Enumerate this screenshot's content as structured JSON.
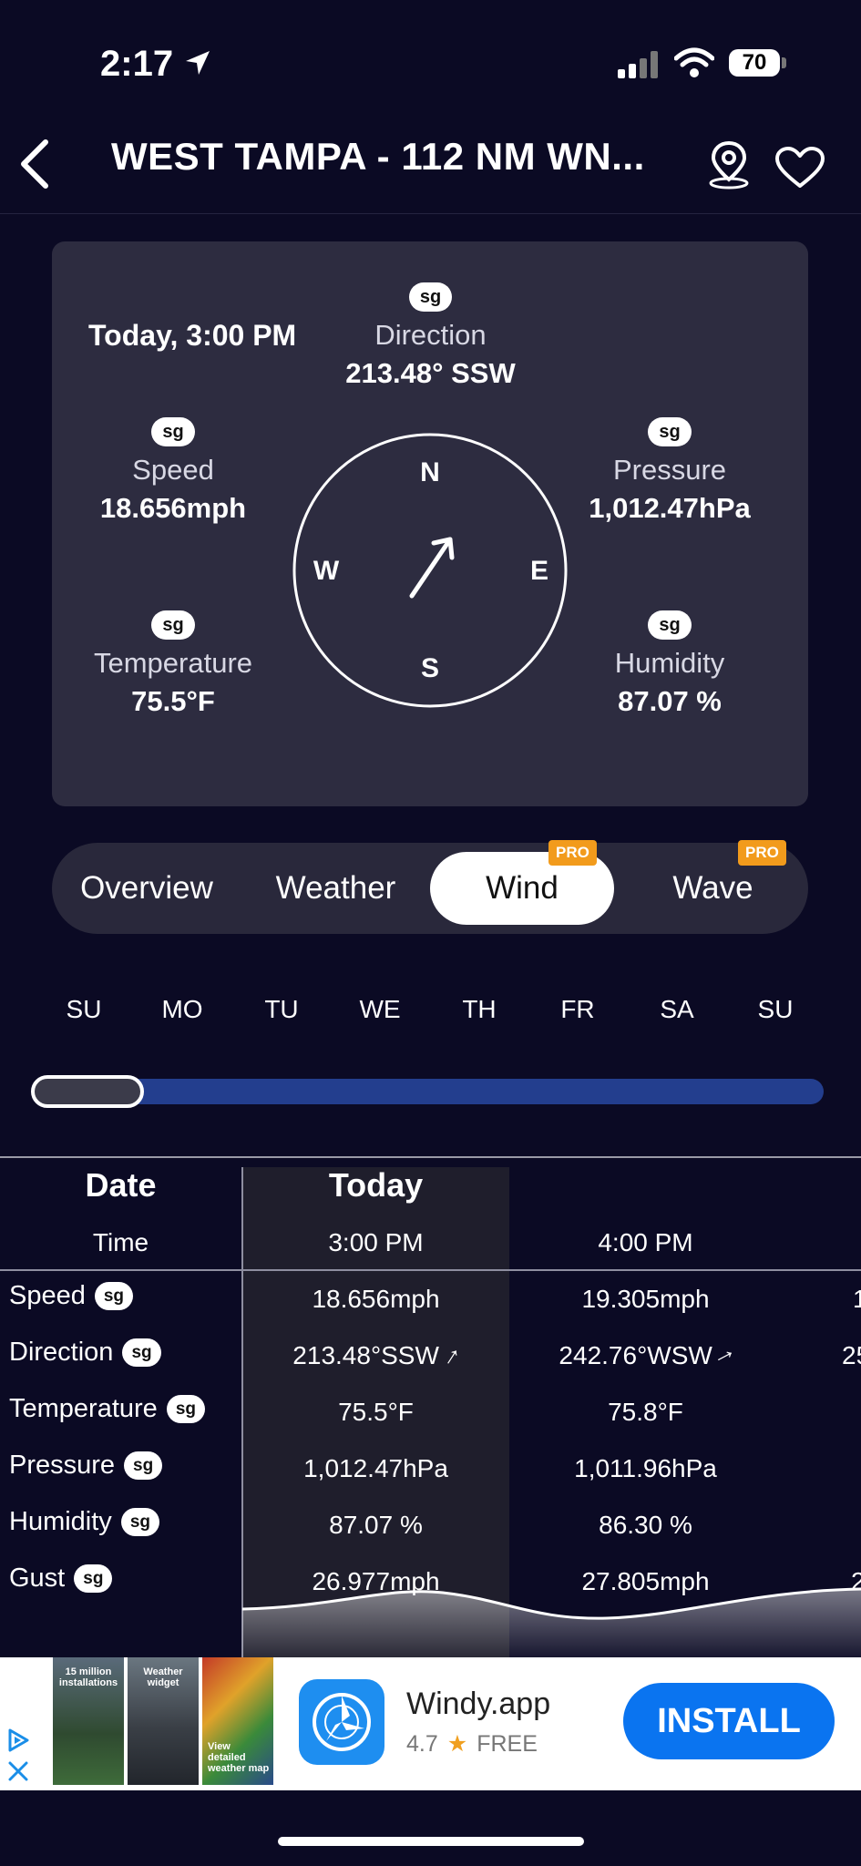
{
  "status_bar": {
    "time": "2:17",
    "battery": "70"
  },
  "header": {
    "title": "WEST TAMPA  - 112 NM WN..."
  },
  "summary": {
    "datetime": "Today, 3:00 PM",
    "source_badge": "sg",
    "direction": {
      "label": "Direction",
      "value": "213.48° SSW"
    },
    "speed": {
      "label": "Speed",
      "value": "18.656mph"
    },
    "pressure": {
      "label": "Pressure",
      "value": "1,012.47hPa"
    },
    "temperature": {
      "label": "Temperature",
      "value": "75.5°F"
    },
    "humidity": {
      "label": "Humidity",
      "value": "87.07 %"
    },
    "compass": {
      "n": "N",
      "e": "E",
      "s": "S",
      "w": "W",
      "heading_deg": 213.48
    }
  },
  "tabs": [
    {
      "label": "Overview",
      "selected": false,
      "pro": false
    },
    {
      "label": "Weather",
      "selected": false,
      "pro": false
    },
    {
      "label": "Wind",
      "selected": true,
      "pro": true
    },
    {
      "label": "Wave",
      "selected": false,
      "pro": true
    }
  ],
  "pro_label": "PRO",
  "days": [
    "SU",
    "MO",
    "TU",
    "WE",
    "TH",
    "FR",
    "SA",
    "SU"
  ],
  "timeline": {
    "position_fraction": 0.0
  },
  "table": {
    "date_header": "Date",
    "time_header": "Time",
    "today_label": "Today",
    "columns": [
      {
        "time": "3:00 PM",
        "speed": "18.656mph",
        "direction": "213.48°SSW",
        "temperature": "75.5°F",
        "pressure": "1,012.47hPa",
        "humidity": "87.07 %",
        "gust": "26.977mph"
      },
      {
        "time": "4:00 PM",
        "speed": "19.305mph",
        "direction": "242.76°WSW",
        "temperature": "75.8°F",
        "pressure": "1,011.96hPa",
        "humidity": "86.30 %",
        "gust": "27.805mph"
      }
    ],
    "partial_next": {
      "speed": "1",
      "direction": "25",
      "gust": "2"
    },
    "rows": [
      {
        "label": "Speed",
        "badge": "sg"
      },
      {
        "label": "Direction",
        "badge": "sg"
      },
      {
        "label": "Temperature",
        "badge": "sg"
      },
      {
        "label": "Pressure",
        "badge": "sg"
      },
      {
        "label": "Humidity",
        "badge": "sg"
      },
      {
        "label": "Gust",
        "badge": "sg"
      }
    ]
  },
  "ad": {
    "thumb1": "15 million installations",
    "thumb2": "Weather widget",
    "thumb3": "View detailed weather map",
    "app_name": "Windy.app",
    "rating": "4.7",
    "price": "FREE",
    "install_label": "INSTALL",
    "colors": {
      "install": "#0a74f0"
    }
  }
}
